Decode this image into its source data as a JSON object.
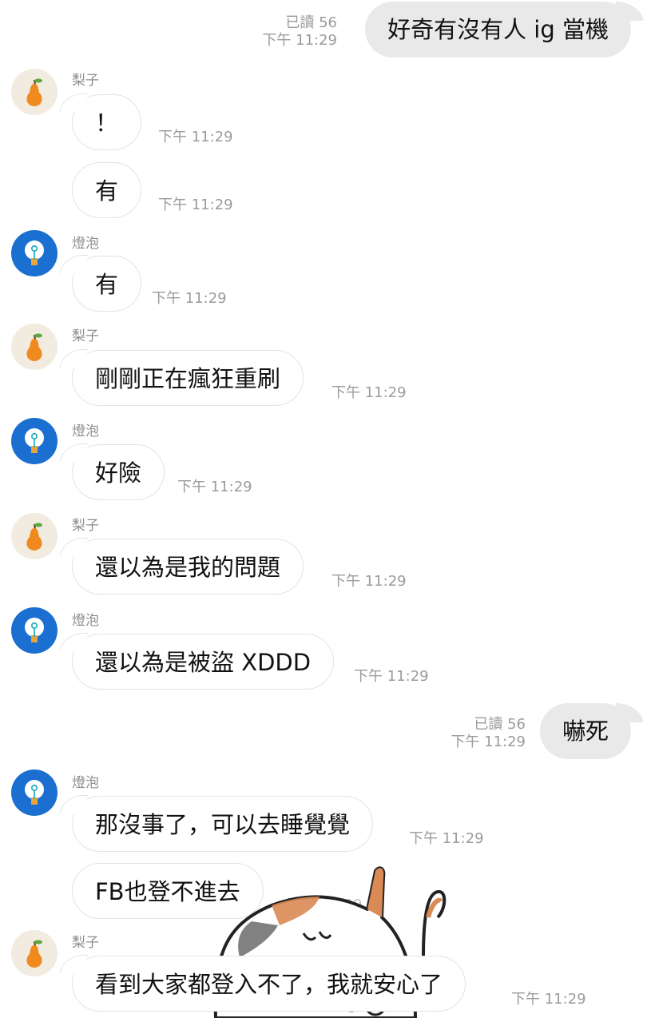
{
  "senders": {
    "pear": "梨子",
    "bulb": "燈泡"
  },
  "messages": [
    {
      "from": "me",
      "text": "好奇有沒有人 ig 當機",
      "read": "已讀 56",
      "time": "下午 11:29"
    },
    {
      "from": "pear",
      "text": "！",
      "time": "下午 11:29"
    },
    {
      "from": "pear",
      "text": "有",
      "time": "下午 11:29"
    },
    {
      "from": "bulb",
      "text": "有",
      "time": "下午 11:29"
    },
    {
      "from": "pear",
      "text": "剛剛正在瘋狂重刷",
      "time": "下午 11:29"
    },
    {
      "from": "bulb",
      "text": "好險",
      "time": "下午 11:29"
    },
    {
      "from": "pear",
      "text": "還以為是我的問題",
      "time": "下午 11:29"
    },
    {
      "from": "bulb",
      "text": "還以為是被盜 XDDD",
      "time": "下午 11:29"
    },
    {
      "from": "me",
      "text": "嚇死",
      "read": "已讀 56",
      "time": "下午 11:29"
    },
    {
      "from": "bulb",
      "text": "那沒事了，可以去睡覺覺",
      "time": "下午 11:29"
    },
    {
      "from": "bulb",
      "text": "FB也登不進去",
      "time": "下午 11:29"
    },
    {
      "from": "pear",
      "text": "看到大家都登入不了，我就安心了",
      "time": "下午 11:29"
    }
  ]
}
